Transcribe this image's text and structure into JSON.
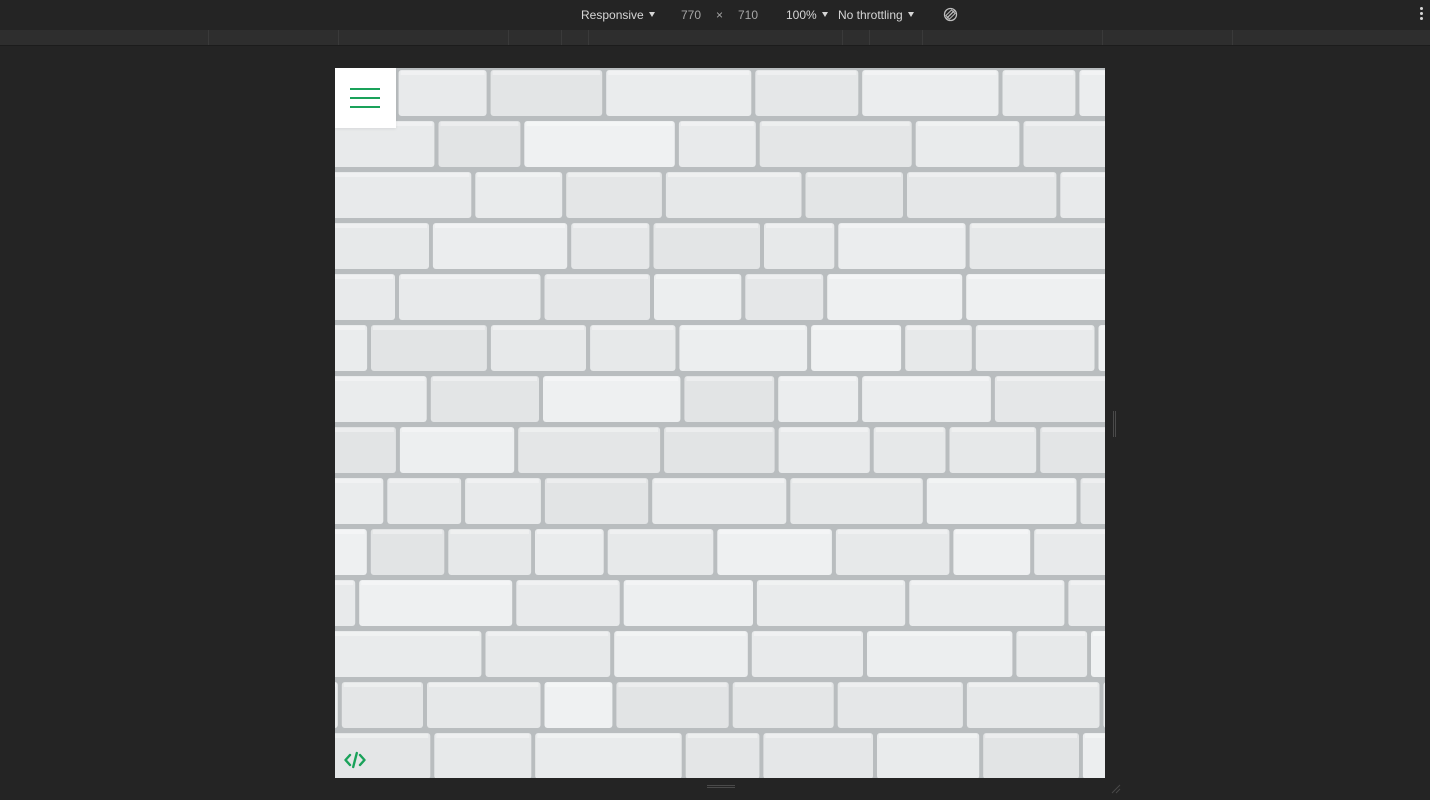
{
  "toolbar": {
    "device_mode": "Responsive",
    "width": "770",
    "height": "710",
    "dimension_separator": "×",
    "zoom": "100%",
    "throttling": "No throttling",
    "rotate_icon": "rotate-icon",
    "more_icon": "more-options-icon"
  },
  "page": {
    "background": "white brick wall",
    "menu_icon": "hamburger-menu-icon",
    "code_icon": "code-icon",
    "accent_color": "#1aa25a"
  }
}
